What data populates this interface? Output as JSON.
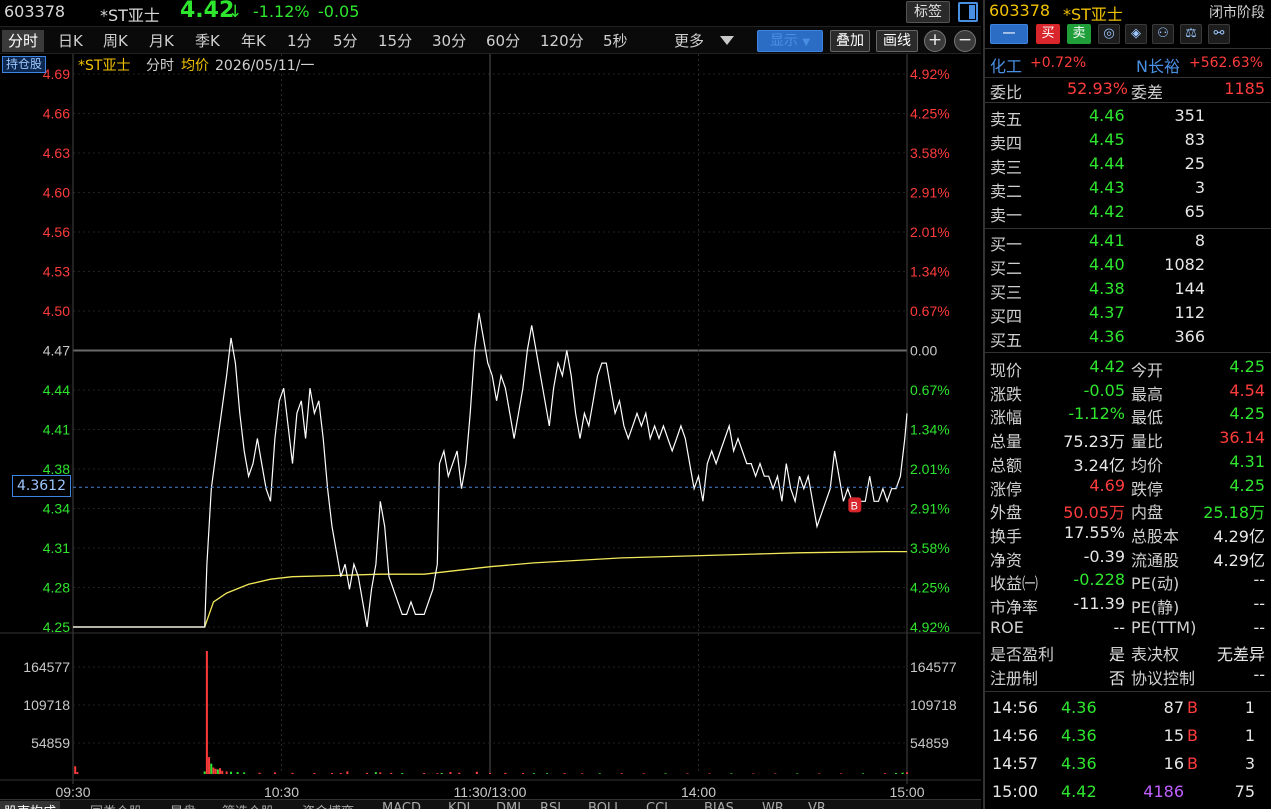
{
  "title_bar": {
    "code": "603378",
    "name": "*ST亚士",
    "price": "4.42",
    "arrow": "↓",
    "change_pct": "-1.12%",
    "change": "-0.05",
    "tag_button": "标签"
  },
  "periods": [
    "分时",
    "日K",
    "周K",
    "月K",
    "季K",
    "年K",
    "1分",
    "5分",
    "15分",
    "30分",
    "60分",
    "120分",
    "5秒",
    "更多"
  ],
  "toolbar": {
    "display": "显示",
    "overlay": "叠加",
    "draw": "画线",
    "zoom_in": "+",
    "zoom_out": "−"
  },
  "chart_header": {
    "holding": "持仓股",
    "name": "*ST亚士",
    "mode": "分时",
    "avg_label": "均价",
    "date": "2026/05/11/一"
  },
  "cursor_value": "4.3612",
  "marker": "B",
  "chart_data": {
    "type": "line",
    "title": "",
    "prev_close": 4.47,
    "price_axis": {
      "ticks": [
        "4.69",
        "4.66",
        "4.63",
        "4.60",
        "4.56",
        "4.53",
        "4.50",
        "4.47",
        "4.44",
        "4.41",
        "4.38",
        "4.34",
        "4.31",
        "4.28",
        "4.25"
      ],
      "range": [
        4.25,
        4.69
      ]
    },
    "pct_axis": {
      "ticks": [
        "4.92%",
        "4.25%",
        "3.58%",
        "2.91%",
        "2.01%",
        "1.34%",
        "0.67%",
        "0.00",
        "0.67%",
        "1.34%",
        "2.01%",
        "2.91%",
        "3.58%",
        "4.25%",
        "4.92%"
      ]
    },
    "volume_axis": {
      "ticks": [
        "164577",
        "109718",
        "54859"
      ],
      "max": 190000
    },
    "time_axis": [
      "09:30",
      "10:30",
      "11:30/13:00",
      "14:00",
      "15:00"
    ],
    "price_series": {
      "name": "",
      "points": [
        [
          0,
          4.25
        ],
        [
          60,
          4.25
        ],
        [
          61,
          4.3
        ],
        [
          63,
          4.36
        ],
        [
          66,
          4.4
        ],
        [
          70,
          4.45
        ],
        [
          72,
          4.48
        ],
        [
          74,
          4.46
        ],
        [
          76,
          4.42
        ],
        [
          78,
          4.39
        ],
        [
          80,
          4.37
        ],
        [
          82,
          4.38
        ],
        [
          84,
          4.4
        ],
        [
          86,
          4.38
        ],
        [
          88,
          4.36
        ],
        [
          90,
          4.35
        ],
        [
          92,
          4.4
        ],
        [
          94,
          4.43
        ],
        [
          96,
          4.44
        ],
        [
          98,
          4.41
        ],
        [
          100,
          4.38
        ],
        [
          102,
          4.42
        ],
        [
          104,
          4.43
        ],
        [
          106,
          4.4
        ],
        [
          108,
          4.44
        ],
        [
          110,
          4.42
        ],
        [
          112,
          4.43
        ],
        [
          114,
          4.4
        ],
        [
          116,
          4.36
        ],
        [
          118,
          4.33
        ],
        [
          120,
          4.31
        ],
        [
          122,
          4.29
        ],
        [
          124,
          4.3
        ],
        [
          126,
          4.28
        ],
        [
          128,
          4.3
        ],
        [
          130,
          4.29
        ],
        [
          132,
          4.27
        ],
        [
          134,
          4.25
        ],
        [
          136,
          4.28
        ],
        [
          138,
          4.3
        ],
        [
          140,
          4.35
        ],
        [
          142,
          4.33
        ],
        [
          144,
          4.29
        ],
        [
          146,
          4.28
        ],
        [
          148,
          4.27
        ],
        [
          150,
          4.26
        ],
        [
          152,
          4.26
        ],
        [
          154,
          4.27
        ],
        [
          156,
          4.26
        ],
        [
          158,
          4.26
        ],
        [
          160,
          4.26
        ],
        [
          162,
          4.27
        ],
        [
          164,
          4.28
        ],
        [
          166,
          4.3
        ],
        [
          167,
          4.38
        ],
        [
          169,
          4.39
        ],
        [
          171,
          4.37
        ],
        [
          173,
          4.38
        ],
        [
          175,
          4.39
        ],
        [
          177,
          4.36
        ],
        [
          179,
          4.38
        ],
        [
          181,
          4.42
        ],
        [
          183,
          4.47
        ],
        [
          185,
          4.5
        ],
        [
          187,
          4.48
        ],
        [
          189,
          4.46
        ],
        [
          191,
          4.45
        ],
        [
          193,
          4.43
        ],
        [
          195,
          4.45
        ],
        [
          197,
          4.44
        ],
        [
          199,
          4.42
        ],
        [
          201,
          4.4
        ],
        [
          203,
          4.42
        ],
        [
          205,
          4.44
        ],
        [
          207,
          4.47
        ],
        [
          209,
          4.49
        ],
        [
          211,
          4.47
        ],
        [
          213,
          4.45
        ],
        [
          215,
          4.43
        ],
        [
          217,
          4.41
        ],
        [
          219,
          4.44
        ],
        [
          221,
          4.46
        ],
        [
          223,
          4.45
        ],
        [
          225,
          4.47
        ],
        [
          227,
          4.45
        ],
        [
          229,
          4.42
        ],
        [
          231,
          4.4
        ],
        [
          233,
          4.42
        ],
        [
          235,
          4.41
        ],
        [
          237,
          4.43
        ],
        [
          239,
          4.45
        ],
        [
          241,
          4.46
        ],
        [
          243,
          4.46
        ],
        [
          245,
          4.44
        ],
        [
          247,
          4.42
        ],
        [
          249,
          4.43
        ],
        [
          251,
          4.41
        ],
        [
          253,
          4.4
        ],
        [
          255,
          4.41
        ],
        [
          257,
          4.42
        ],
        [
          259,
          4.41
        ],
        [
          261,
          4.42
        ],
        [
          263,
          4.4
        ],
        [
          265,
          4.41
        ],
        [
          267,
          4.4
        ],
        [
          269,
          4.41
        ],
        [
          271,
          4.4
        ],
        [
          273,
          4.39
        ],
        [
          275,
          4.4
        ],
        [
          277,
          4.41
        ],
        [
          279,
          4.4
        ],
        [
          281,
          4.38
        ],
        [
          283,
          4.36
        ],
        [
          285,
          4.37
        ],
        [
          287,
          4.35
        ],
        [
          289,
          4.38
        ],
        [
          291,
          4.39
        ],
        [
          293,
          4.38
        ],
        [
          295,
          4.39
        ],
        [
          297,
          4.4
        ],
        [
          299,
          4.41
        ],
        [
          301,
          4.39
        ],
        [
          303,
          4.4
        ],
        [
          305,
          4.39
        ],
        [
          307,
          4.38
        ],
        [
          309,
          4.38
        ],
        [
          311,
          4.37
        ],
        [
          313,
          4.38
        ],
        [
          315,
          4.37
        ],
        [
          317,
          4.37
        ],
        [
          319,
          4.36
        ],
        [
          321,
          4.37
        ],
        [
          323,
          4.35
        ],
        [
          325,
          4.38
        ],
        [
          327,
          4.36
        ],
        [
          329,
          4.35
        ],
        [
          331,
          4.37
        ],
        [
          333,
          4.36
        ],
        [
          335,
          4.37
        ],
        [
          337,
          4.35
        ],
        [
          339,
          4.33
        ],
        [
          341,
          4.34
        ],
        [
          343,
          4.35
        ],
        [
          345,
          4.36
        ],
        [
          347,
          4.39
        ],
        [
          349,
          4.37
        ],
        [
          351,
          4.35
        ],
        [
          353,
          4.36
        ],
        [
          355,
          4.35
        ],
        [
          357,
          4.35
        ],
        [
          359,
          4.35
        ],
        [
          361,
          4.35
        ],
        [
          363,
          4.37
        ],
        [
          365,
          4.35
        ],
        [
          367,
          4.35
        ],
        [
          369,
          4.36
        ],
        [
          371,
          4.35
        ],
        [
          373,
          4.36
        ],
        [
          375,
          4.36
        ],
        [
          377,
          4.37
        ],
        [
          379,
          4.4
        ],
        [
          380,
          4.42
        ]
      ]
    },
    "avg_series": {
      "name": "均价",
      "points": [
        [
          0,
          4.25
        ],
        [
          60,
          4.25
        ],
        [
          64,
          4.27
        ],
        [
          70,
          4.277
        ],
        [
          80,
          4.284
        ],
        [
          90,
          4.288
        ],
        [
          100,
          4.29
        ],
        [
          120,
          4.291
        ],
        [
          140,
          4.292
        ],
        [
          160,
          4.292
        ],
        [
          170,
          4.294
        ],
        [
          190,
          4.298
        ],
        [
          210,
          4.301
        ],
        [
          230,
          4.303
        ],
        [
          250,
          4.305
        ],
        [
          270,
          4.306
        ],
        [
          290,
          4.307
        ],
        [
          310,
          4.308
        ],
        [
          330,
          4.309
        ],
        [
          350,
          4.3095
        ],
        [
          370,
          4.31
        ],
        [
          380,
          4.31
        ]
      ]
    },
    "volume_bars": [
      [
        1,
        12000
      ],
      [
        2,
        3000
      ],
      [
        60,
        4000
      ],
      [
        61,
        190000
      ],
      [
        62,
        26000
      ],
      [
        63,
        16000
      ],
      [
        64,
        10000
      ],
      [
        65,
        8000
      ],
      [
        66,
        7000
      ],
      [
        67,
        9000
      ],
      [
        68,
        5000
      ],
      [
        70,
        4000
      ],
      [
        72,
        3500
      ],
      [
        75,
        3000
      ],
      [
        78,
        2500
      ],
      [
        85,
        2000
      ],
      [
        92,
        2500
      ],
      [
        100,
        1800
      ],
      [
        110,
        1600
      ],
      [
        118,
        1500
      ],
      [
        122,
        1500
      ],
      [
        125,
        4000
      ],
      [
        134,
        1800
      ],
      [
        138,
        2800
      ],
      [
        140,
        2500
      ],
      [
        145,
        1800
      ],
      [
        150,
        1500
      ],
      [
        160,
        1500
      ],
      [
        166,
        1200
      ],
      [
        168,
        1500
      ],
      [
        172,
        3000
      ],
      [
        176,
        2000
      ],
      [
        184,
        3500
      ],
      [
        190,
        1800
      ],
      [
        197,
        1800
      ],
      [
        205,
        1500
      ],
      [
        210,
        1300
      ],
      [
        216,
        1200
      ],
      [
        224,
        1300
      ],
      [
        232,
        1100
      ],
      [
        240,
        1100
      ],
      [
        250,
        1200
      ],
      [
        260,
        1100
      ],
      [
        270,
        1000
      ],
      [
        280,
        1000
      ],
      [
        290,
        1000
      ],
      [
        300,
        1000
      ],
      [
        310,
        900
      ],
      [
        320,
        900
      ],
      [
        330,
        900
      ],
      [
        340,
        900
      ],
      [
        350,
        1000
      ],
      [
        360,
        1000
      ],
      [
        370,
        1200
      ],
      [
        375,
        1500
      ],
      [
        378,
        2200
      ],
      [
        380,
        2600
      ]
    ]
  },
  "bottom_tabs": [
    "股東构成",
    "同类个股",
    "早盘",
    "筛选个股",
    "资金博弈",
    "MACD",
    "KDJ",
    "DMI",
    "RSI",
    "BOLL",
    "CCI",
    "BIAS",
    "WR",
    "VR"
  ],
  "right_panel": {
    "code": "603378",
    "name": "*ST亚士",
    "status": "闭市阶段",
    "btn_minus": "一",
    "btn_buy": "买",
    "btn_sell": "卖",
    "icons": [
      "target-icon",
      "compass-icon",
      "people-icon",
      "balance-icon",
      "connect-icon"
    ],
    "index_left": {
      "name": "化工",
      "pct": "+0.72%"
    },
    "index_right": {
      "name": "N长裕",
      "pct": "+562.63%"
    },
    "weibi_label": "委比",
    "weibi": "52.93%",
    "weicha_label": "委差",
    "weicha": "1185",
    "asks": [
      {
        "label": "卖五",
        "price": "4.46",
        "vol": "351"
      },
      {
        "label": "卖四",
        "price": "4.45",
        "vol": "83"
      },
      {
        "label": "卖三",
        "price": "4.44",
        "vol": "25"
      },
      {
        "label": "卖二",
        "price": "4.43",
        "vol": "3"
      },
      {
        "label": "卖一",
        "price": "4.42",
        "vol": "65"
      }
    ],
    "bids": [
      {
        "label": "买一",
        "price": "4.41",
        "vol": "8"
      },
      {
        "label": "买二",
        "price": "4.40",
        "vol": "1082"
      },
      {
        "label": "买三",
        "price": "4.38",
        "vol": "144"
      },
      {
        "label": "买四",
        "price": "4.37",
        "vol": "112"
      },
      {
        "label": "买五",
        "price": "4.36",
        "vol": "366"
      }
    ],
    "stats": [
      {
        "l1": "现价",
        "v1": "4.42",
        "c1": "green",
        "l2": "今开",
        "v2": "4.25",
        "c2": "green"
      },
      {
        "l1": "涨跌",
        "v1": "-0.05",
        "c1": "green",
        "l2": "最高",
        "v2": "4.54",
        "c2": "red"
      },
      {
        "l1": "涨幅",
        "v1": "-1.12%",
        "c1": "green",
        "l2": "最低",
        "v2": "4.25",
        "c2": "green"
      },
      {
        "l1": "总量",
        "v1": "75.23万",
        "c1": "white",
        "l2": "量比",
        "v2": "36.14",
        "c2": "red"
      },
      {
        "l1": "总额",
        "v1": "3.24亿",
        "c1": "white",
        "l2": "均价",
        "v2": "4.31",
        "c2": "green"
      },
      {
        "l1": "涨停",
        "v1": "4.69",
        "c1": "red",
        "l2": "跌停",
        "v2": "4.25",
        "c2": "green"
      },
      {
        "l1": "外盘",
        "v1": "50.05万",
        "c1": "red",
        "l2": "内盘",
        "v2": "25.18万",
        "c2": "green"
      },
      {
        "l1": "换手",
        "v1": "17.55%",
        "c1": "white",
        "l2": "总股本",
        "v2": "4.29亿",
        "c2": "white"
      },
      {
        "l1": "净资",
        "v1": "-0.39",
        "c1": "white",
        "l2": "流通股",
        "v2": "4.29亿",
        "c2": "white"
      },
      {
        "l1": "收益㈠",
        "v1": "-0.228",
        "c1": "green",
        "l2": "PE(动)",
        "v2": "--",
        "c2": "white"
      },
      {
        "l1": "市净率",
        "v1": "-11.39",
        "c1": "white",
        "l2": "PE(静)",
        "v2": "--",
        "c2": "white"
      },
      {
        "l1": "ROE",
        "v1": "--",
        "c1": "white",
        "l2": "PE(TTM)",
        "v2": "--",
        "c2": "white"
      },
      {
        "l1": "是否盈利",
        "v1": "是",
        "c1": "white",
        "l2": "表决权",
        "v2": "无差异",
        "c2": "white"
      },
      {
        "l1": "注册制",
        "v1": "否",
        "c1": "white",
        "l2": "协议控制",
        "v2": "--",
        "c2": "white"
      }
    ],
    "ticks": [
      {
        "time": "14:56",
        "price": "4.36",
        "vol": "87",
        "dir": "B",
        "num": "1",
        "vol_color": "white"
      },
      {
        "time": "14:56",
        "price": "4.36",
        "vol": "15",
        "dir": "B",
        "num": "1",
        "vol_color": "white"
      },
      {
        "time": "14:57",
        "price": "4.36",
        "vol": "16",
        "dir": "B",
        "num": "3",
        "vol_color": "white"
      },
      {
        "time": "15:00",
        "price": "4.42",
        "vol": "4186",
        "dir": "",
        "num": "75",
        "vol_color": "purple"
      }
    ]
  }
}
